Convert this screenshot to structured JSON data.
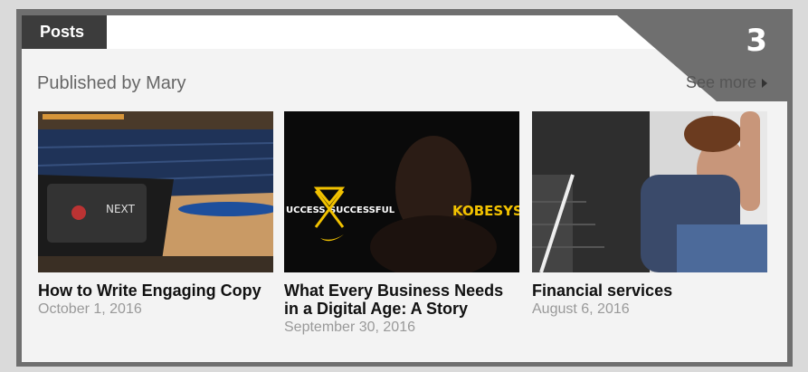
{
  "header": {
    "tab_label": "Posts",
    "badge_number": "3"
  },
  "section": {
    "title": "Published by Mary",
    "see_more": "See more"
  },
  "posts": [
    {
      "title": "How to Write Engaging Copy",
      "date": "October 1, 2016"
    },
    {
      "title": "What Every Business Needs in a Digital Age: A Story",
      "date": "September 30, 2016",
      "image_text": {
        "left": "UCCESS",
        "right": "SUCCESSFUL",
        "brand": "KOBESYSTEM"
      }
    },
    {
      "title": "Financial services",
      "date": "August 6, 2016"
    }
  ],
  "colors": {
    "frame": "#6f6f6f",
    "tab": "#3c3c3c",
    "panel": "#f3f3f3",
    "corner": "#6f6f6f",
    "kobe_yellow": "#f2c200"
  }
}
